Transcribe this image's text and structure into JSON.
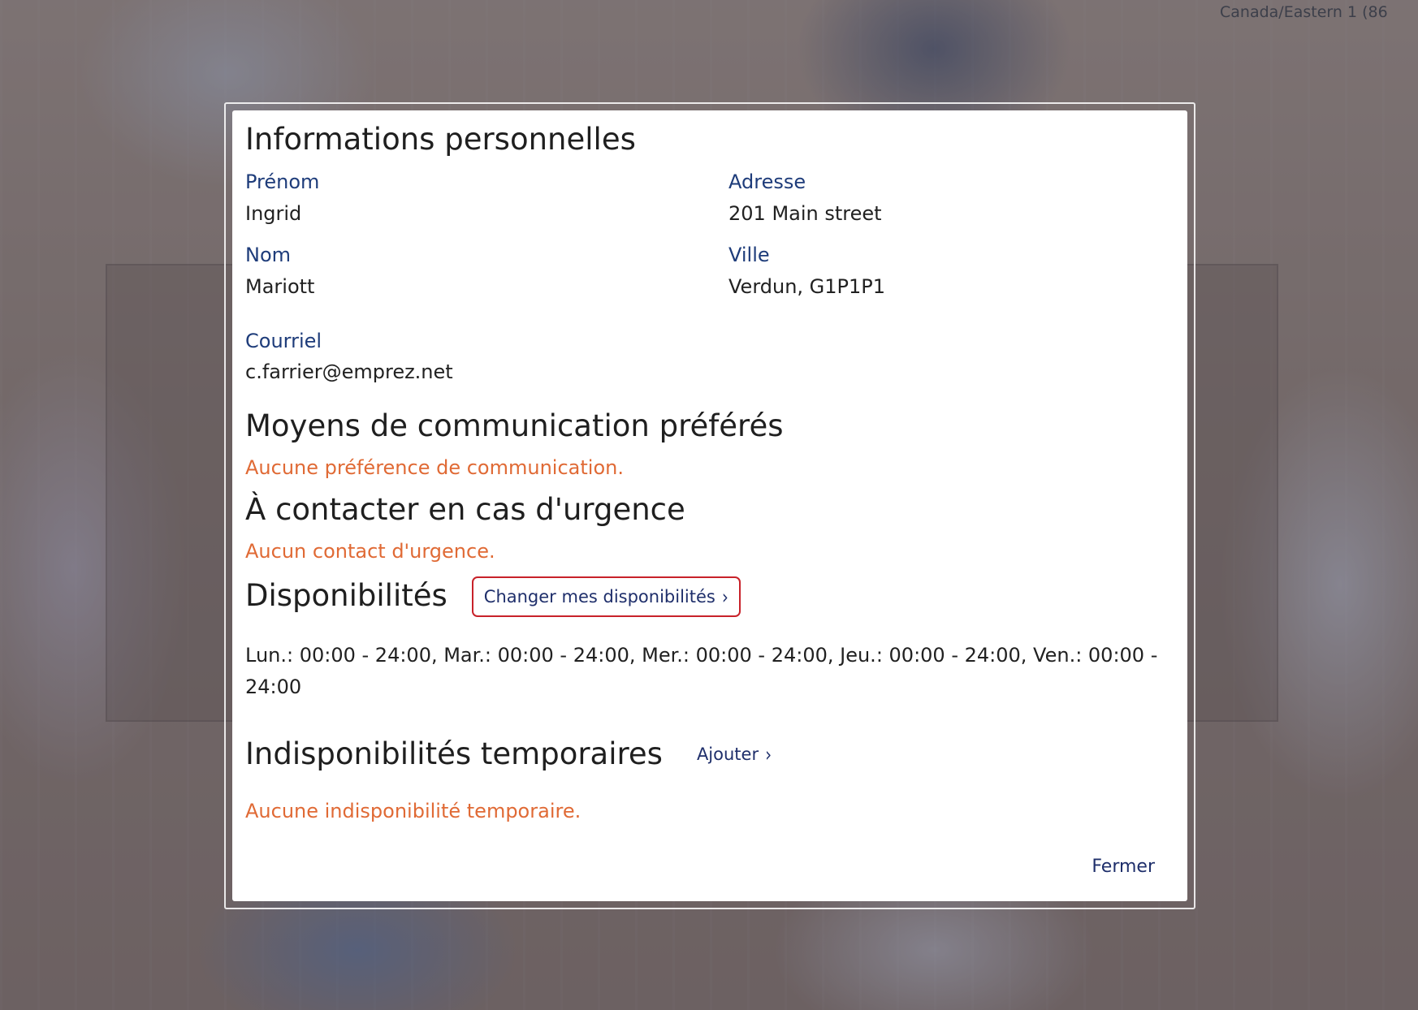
{
  "timezone": "Canada/Eastern 1 (86",
  "modal": {
    "title": "Informations personnelles",
    "fields": {
      "first_name_label": "Prénom",
      "first_name": "Ingrid",
      "address_label": "Adresse",
      "address": "201 Main street",
      "last_name_label": "Nom",
      "last_name": "Mariott",
      "city_label": "Ville",
      "city": "Verdun, G1P1P1",
      "email_label": "Courriel",
      "email": "c.farrier@emprez.net"
    },
    "communication": {
      "title": "Moyens de communication préférés",
      "empty": "Aucune préférence de communication."
    },
    "emergency": {
      "title": "À contacter en cas d'urgence",
      "empty": "Aucun contact d'urgence."
    },
    "availability": {
      "title": "Disponibilités",
      "change_button": "Changer mes disponibilités",
      "schedule": "Lun.: 00:00 - 24:00, Mar.: 00:00 - 24:00, Mer.: 00:00 - 24:00, Jeu.: 00:00 - 24:00, Ven.: 00:00 - 24:00"
    },
    "temporary": {
      "title": "Indisponibilités temporaires",
      "add_button": "Ajouter",
      "empty": "Aucune indisponibilité temporaire."
    },
    "close_button": "Fermer"
  },
  "icons": {
    "chevron": "›"
  },
  "colors": {
    "label_blue": "#1e3c7a",
    "empty_orange": "#e06a35",
    "button_border_red": "#c8222a",
    "link_navy": "#1f2f6b"
  }
}
